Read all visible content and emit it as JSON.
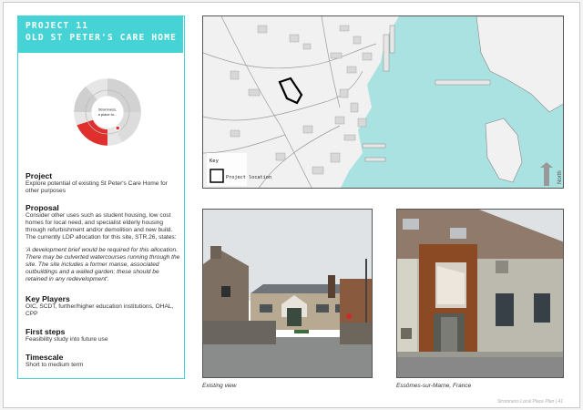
{
  "project": {
    "number": "PROJECT 11",
    "name": "OLD ST PETER'S CARE HOME"
  },
  "wheel": {
    "center_line1": "Stromness,",
    "center_line2": "a place to..."
  },
  "sections": {
    "project": {
      "heading": "Project",
      "text": "Explore potential of existing St Peter's Care Home for other purposes"
    },
    "proposal": {
      "heading": "Proposal",
      "text": "Consider other uses such as student housing, low cost homes for local need, and specialist elderly housing through refurbishment and/or demolition and new build. The currently LDP allocation for this site, STR.26, states:",
      "quote": "'A development brief would be required for this allocation. There may be culverted watercourses running through the site. The site includes a former manse, associated outbuildings and a walled garden; these should be retained in any redevelopment'."
    },
    "players": {
      "heading": "Key Players",
      "text": "OIC, SCDT, further/higher education institutions, OHAL, CPP"
    },
    "steps": {
      "heading": "First steps",
      "text": "Feasibility study into future use"
    },
    "timescale": {
      "heading": "Timescale",
      "text": "Short to medium term"
    }
  },
  "map": {
    "key_label": "Key",
    "location_label": "Project location",
    "north_label": "North"
  },
  "photos": {
    "left_caption": "Existing view",
    "right_caption": "Essômes-sur-Marne, France"
  },
  "footer": "Stromness Local Place Plan | 41",
  "colors": {
    "accent": "#45d3d6",
    "sea": "#a9e2e1",
    "wheel_red": "#e0302e"
  }
}
